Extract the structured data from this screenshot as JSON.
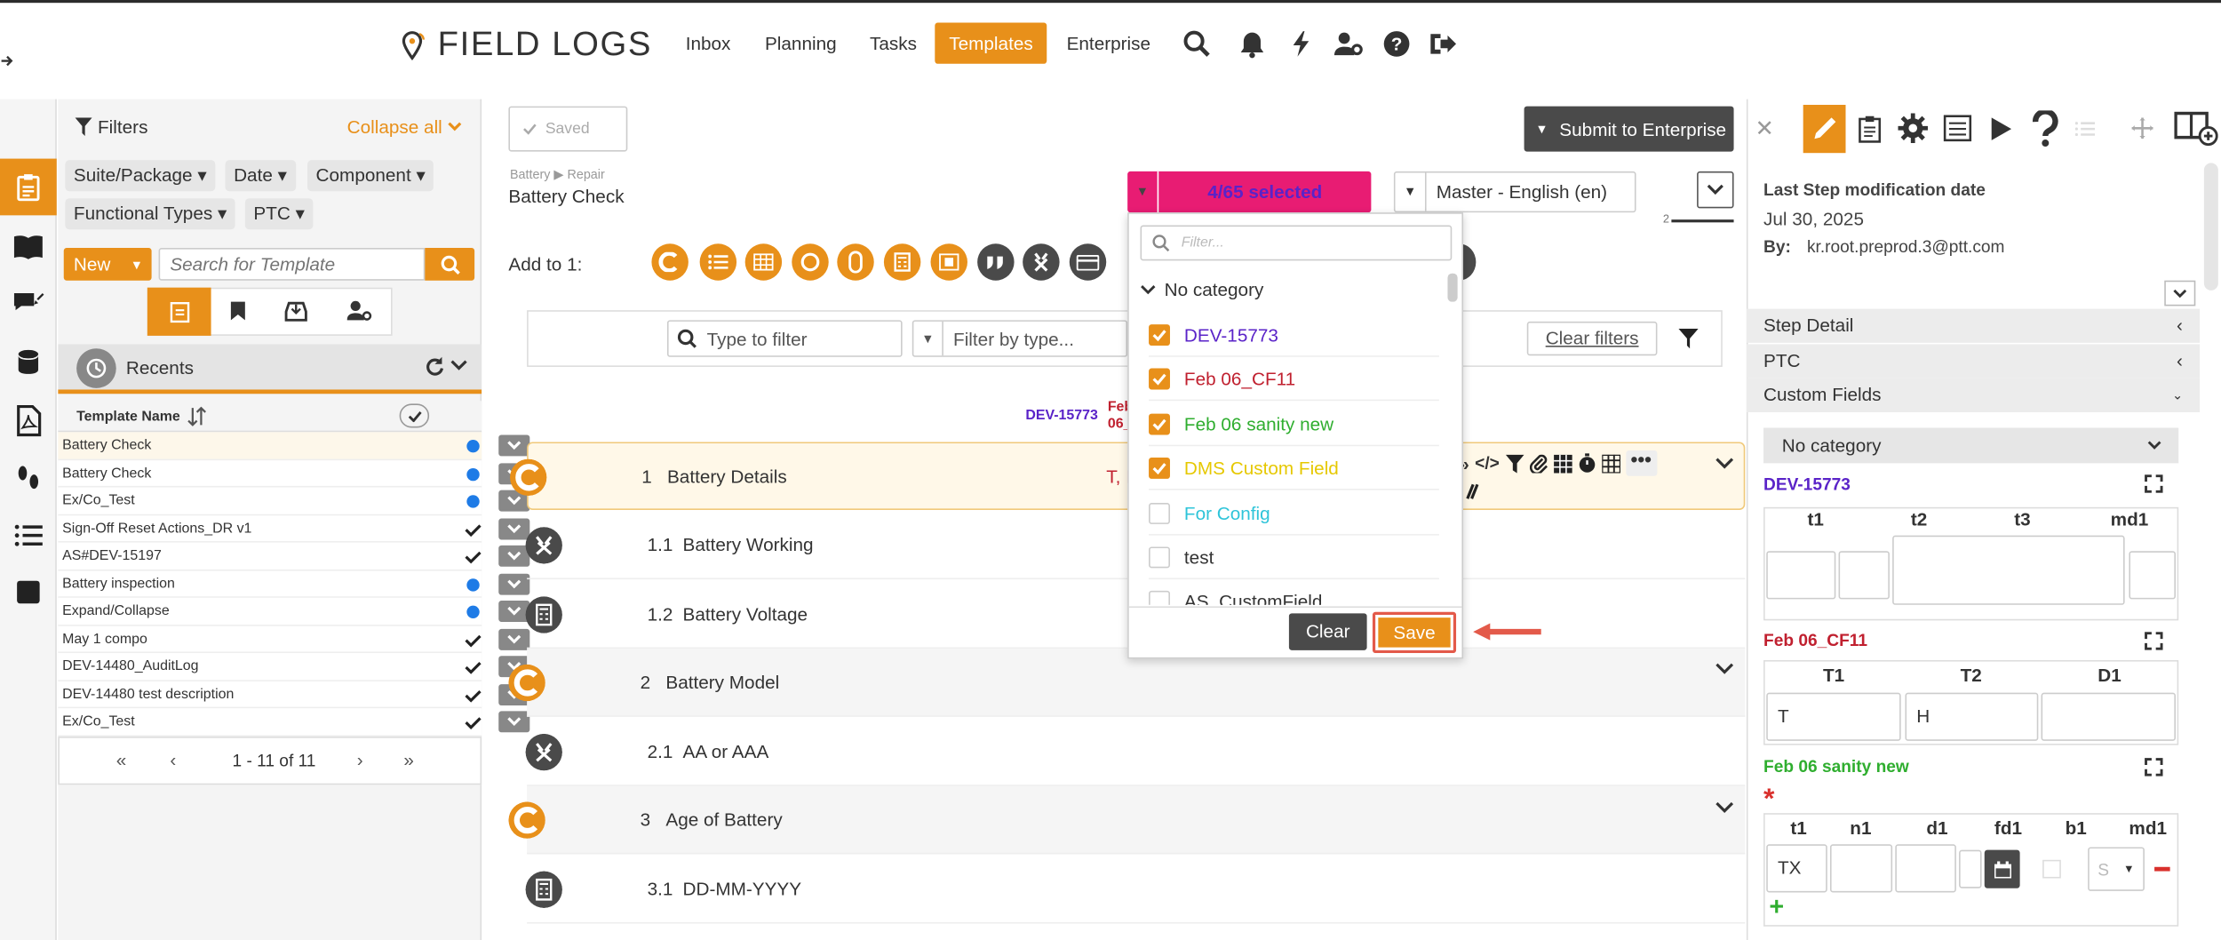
{
  "header": {
    "logo": "FIELD LOGS",
    "nav": [
      "Inbox",
      "Planning",
      "Tasks",
      "Templates",
      "Enterprise"
    ],
    "active": "Templates"
  },
  "filters": {
    "title": "Filters",
    "collapse_all": "Collapse all",
    "chips": [
      "Suite/Package",
      "Date",
      "Component",
      "Functional Types",
      "PTC"
    ],
    "new_label": "New",
    "search_placeholder": "Search for Template",
    "recents": "Recents",
    "col_header": "Template Name",
    "pagination": "1 - 11 of 11",
    "rows": [
      {
        "name": "Battery Check",
        "status": "dot"
      },
      {
        "name": "Battery Check",
        "status": "dot"
      },
      {
        "name": "Ex/Co_Test",
        "status": "dot"
      },
      {
        "name": "Sign-Off Reset Actions_DR v1",
        "status": "check"
      },
      {
        "name": "AS#DEV-15197",
        "status": "check"
      },
      {
        "name": "Battery inspection",
        "status": "dot"
      },
      {
        "name": "Expand/Collapse",
        "status": "dot"
      },
      {
        "name": "May 1 compo",
        "status": "check"
      },
      {
        "name": "DEV-14480_AuditLog",
        "status": "check"
      },
      {
        "name": "DEV-14480 test description",
        "status": "check"
      },
      {
        "name": "Ex/Co_Test",
        "status": "check"
      }
    ]
  },
  "main": {
    "saved": "Saved",
    "submit": "Submit to Enterprise",
    "crumb1": "Battery",
    "crumb2": "Repair",
    "title": "Battery Check",
    "selected": "4/65 selected",
    "language": "Master - English (en)",
    "add_to": "Add to 1:",
    "type_filter": "Type to filter",
    "filter_type": "Filter by type...",
    "clear_filters": "Clear filters",
    "col_dev": "DEV-15773",
    "col_feb": "Feb 06_",
    "row1_cols": "T, I",
    "steps": [
      {
        "num": "1",
        "title": "Battery Details",
        "kind": "group"
      },
      {
        "num": "1.1",
        "title": "Battery Working",
        "kind": "x"
      },
      {
        "num": "1.2",
        "title": "Battery Voltage",
        "kind": "calc"
      },
      {
        "num": "2",
        "title": "Battery Model",
        "kind": "group"
      },
      {
        "num": "2.1",
        "title": "AA or AAA",
        "kind": "x"
      },
      {
        "num": "3",
        "title": "Age of Battery",
        "kind": "group"
      },
      {
        "num": "3.1",
        "title": "DD-MM-YYYY",
        "kind": "calc"
      }
    ],
    "page_indicator": "2"
  },
  "dropdown": {
    "placeholder": "Filter...",
    "category": "No category",
    "clear": "Clear",
    "save": "Save",
    "options": [
      {
        "label": "DEV-15773",
        "checked": true,
        "color": "#5a23c8"
      },
      {
        "label": "Feb 06_CF11",
        "checked": true,
        "color": "#c0202f"
      },
      {
        "label": "Feb 06 sanity new",
        "checked": true,
        "color": "#2fae2f"
      },
      {
        "label": "DMS Custom Field",
        "checked": true,
        "color": "#e6c800"
      },
      {
        "label": "For Config",
        "checked": false,
        "color": "#2ec4d9"
      },
      {
        "label": "test",
        "checked": false,
        "color": "#333333"
      },
      {
        "label": "AS_CustomField",
        "checked": false,
        "color": "#333333"
      }
    ]
  },
  "right": {
    "mod_label": "Last Step modification date",
    "mod_date": "Jul 30, 2025",
    "by_label": "By:",
    "by_user": "kr.root.preprod.3@ptt.com",
    "sections": [
      "Step Detail",
      "PTC",
      "Custom Fields"
    ],
    "no_category": "No category",
    "cf1": {
      "title": "DEV-15773",
      "cols": [
        "t1",
        "t2",
        "t3",
        "md1"
      ]
    },
    "cf2": {
      "title": "Feb 06_CF11",
      "cols": [
        "T1",
        "T2",
        "D1"
      ],
      "values": [
        "T",
        "H",
        ""
      ]
    },
    "cf3": {
      "title": "Feb 06 sanity new",
      "cols": [
        "t1",
        "n1",
        "d1",
        "fd1",
        "b1",
        "md1"
      ],
      "t1": "TX",
      "select": "S"
    }
  },
  "colors": {
    "accent": "#e8901a",
    "pink": "#e81c73",
    "dark": "#4a4a4a"
  }
}
